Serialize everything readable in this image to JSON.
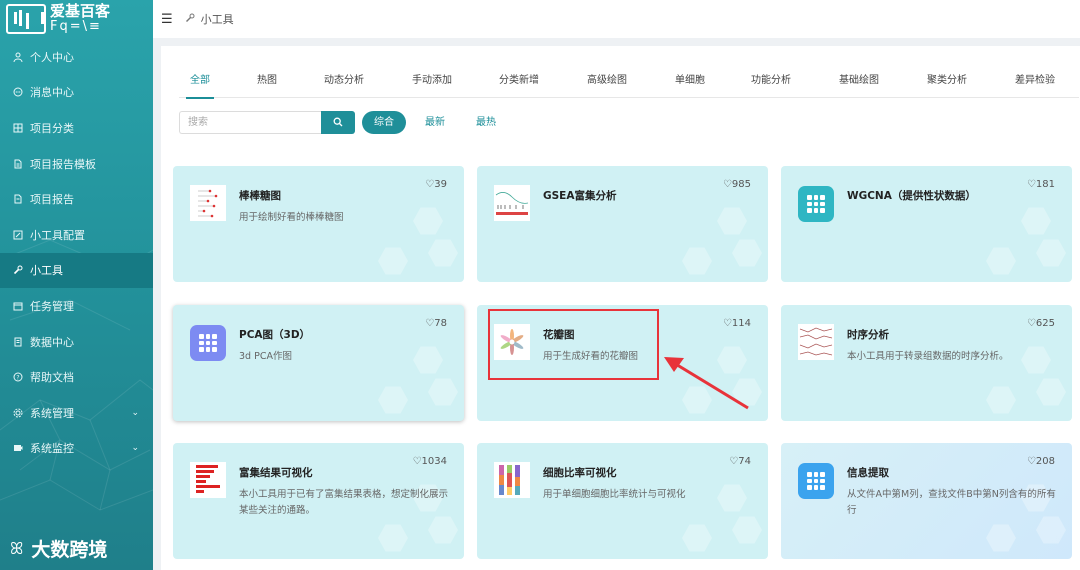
{
  "sidebar": {
    "logo_title": "爱基百客",
    "logo_sub": "Fq=\\≡",
    "items": [
      {
        "label": "个人中心",
        "icon": "user-icon"
      },
      {
        "label": "消息中心",
        "icon": "message-icon"
      },
      {
        "label": "项目分类",
        "icon": "category-icon"
      },
      {
        "label": "项目报告模板",
        "icon": "document-icon"
      },
      {
        "label": "项目报告",
        "icon": "report-icon"
      },
      {
        "label": "小工具配置",
        "icon": "edit-icon"
      },
      {
        "label": "小工具",
        "icon": "wrench-icon"
      },
      {
        "label": "任务管理",
        "icon": "task-icon"
      },
      {
        "label": "数据中心",
        "icon": "data-icon"
      },
      {
        "label": "帮助文档",
        "icon": "help-icon"
      },
      {
        "label": "系统管理",
        "icon": "gear-icon"
      },
      {
        "label": "系统监控",
        "icon": "monitor-icon"
      }
    ],
    "brand": "大数跨境",
    "brand_icon": "ꕤ"
  },
  "topbar": {
    "breadcrumb": "小工具"
  },
  "tabs": [
    "全部",
    "热图",
    "动态分析",
    "手动添加",
    "分类新增",
    "高级绘图",
    "单细胞",
    "功能分析",
    "基础绘图",
    "聚类分析",
    "差异检验"
  ],
  "search": {
    "placeholder": "搜索"
  },
  "sort": [
    "综合",
    "最新",
    "最热"
  ],
  "cards": [
    {
      "title": "棒棒糖图",
      "desc": "用于绘制好看的棒棒糖图",
      "likes": "♡39"
    },
    {
      "title": "GSEA富集分析",
      "desc": "",
      "likes": "♡985"
    },
    {
      "title": "WGCNA（提供性状数据）",
      "desc": "",
      "likes": "♡181"
    },
    {
      "title": "PCA图（3D）",
      "desc": "3d PCA作图",
      "likes": "♡78"
    },
    {
      "title": "花瓣图",
      "desc": "用于生成好看的花瓣图",
      "likes": "♡114"
    },
    {
      "title": "时序分析",
      "desc": "本小工具用于转录组数据的时序分析。",
      "likes": "♡625"
    },
    {
      "title": "富集结果可视化",
      "desc": "本小工具用于已有了富集结果表格，想定制化展示某些关注的通路。",
      "likes": "♡1034"
    },
    {
      "title": "细胞比率可视化",
      "desc": "用于单细胞细胞比率统计与可视化",
      "likes": "♡74"
    },
    {
      "title": "信息提取",
      "desc": "从文件A中第M列，查找文件B中第N列含有的所有行",
      "likes": "♡208"
    }
  ],
  "colors": {
    "accent": "#1f8f99",
    "card_bg": "#d0f1f4",
    "highlight": "#e8333a"
  }
}
